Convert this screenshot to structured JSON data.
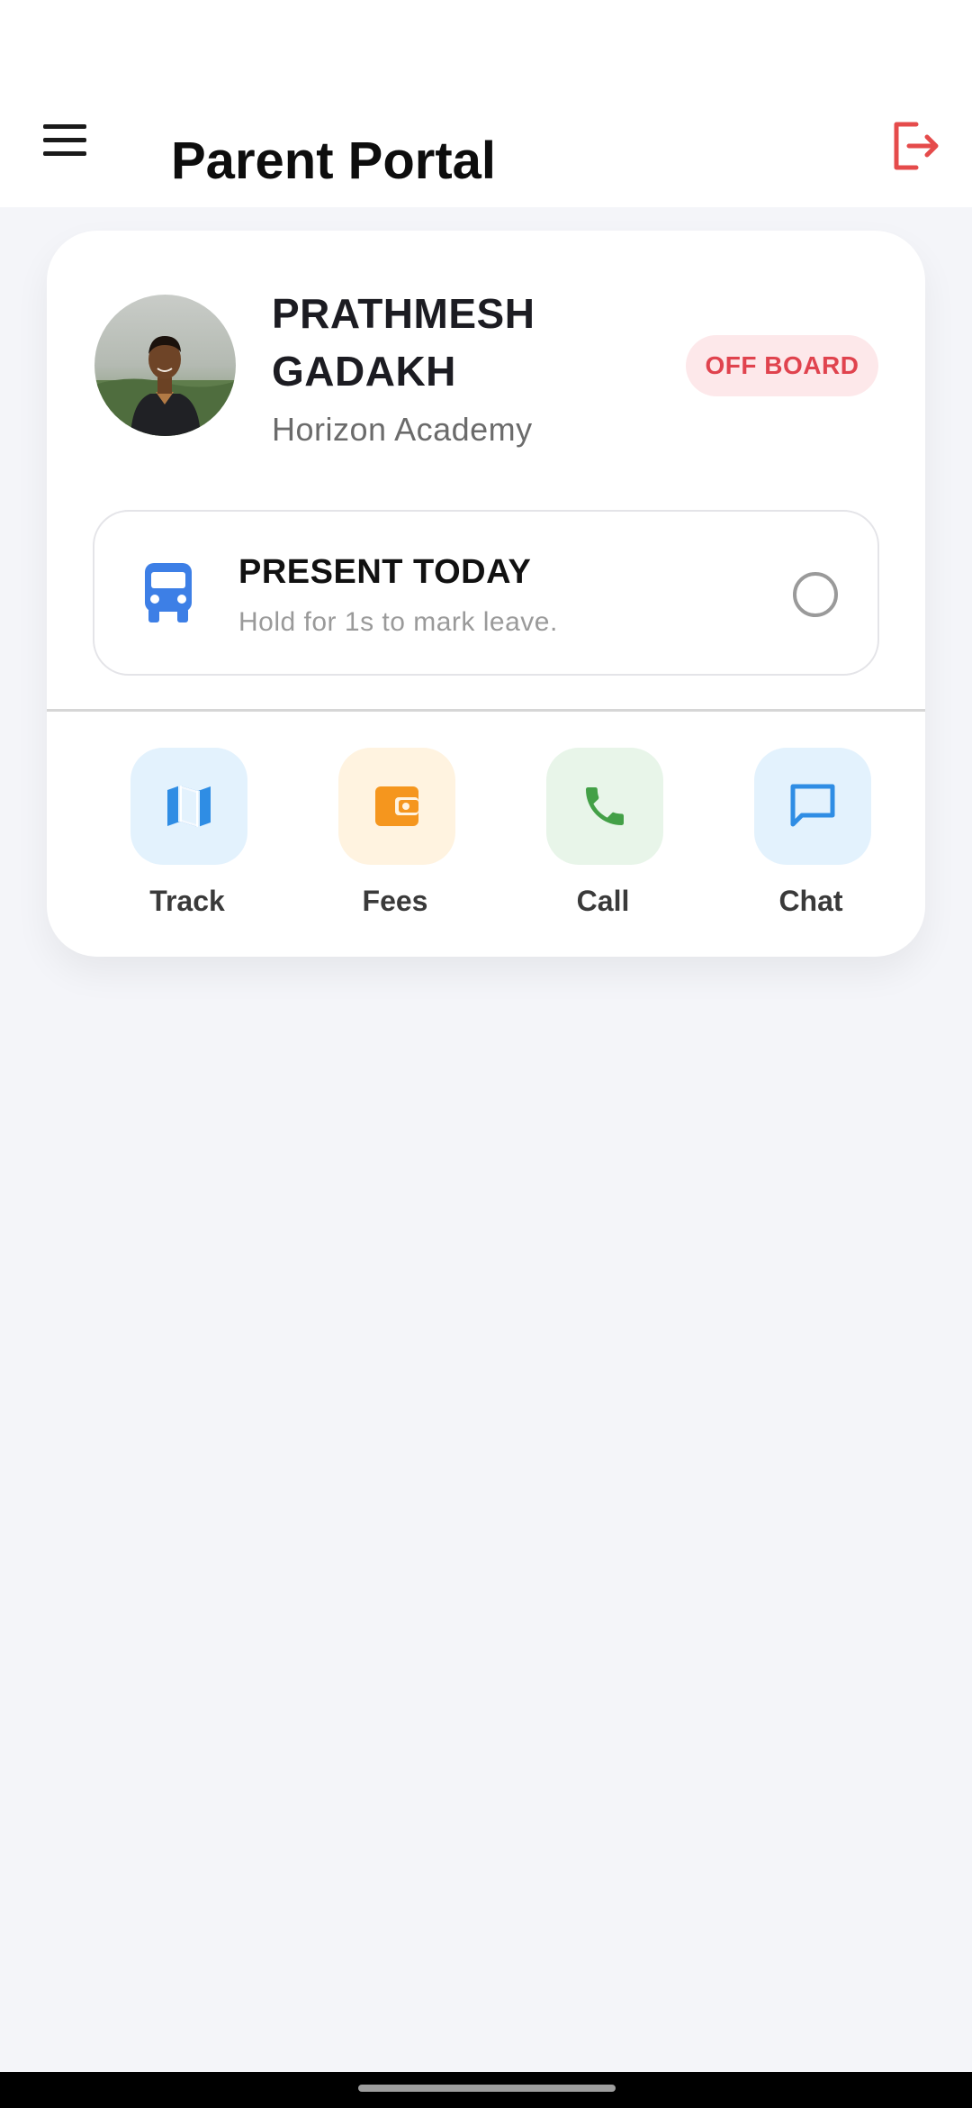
{
  "app": {
    "title": "Parent Portal"
  },
  "student": {
    "name": "PRATHMESH GADAKH",
    "school": "Horizon Academy",
    "status": "OFF BOARD"
  },
  "attendance": {
    "title": "PRESENT TODAY",
    "subtitle": "Hold for 1s to mark leave."
  },
  "actions": [
    {
      "label": "Track",
      "icon": "map-icon"
    },
    {
      "label": "Fees",
      "icon": "wallet-icon"
    },
    {
      "label": "Call",
      "icon": "phone-icon"
    },
    {
      "label": "Chat",
      "icon": "chat-icon"
    }
  ],
  "colors": {
    "accent_blue": "#2f8de4",
    "bus_blue": "#3d7fe6",
    "fees_orange": "#f5961e",
    "call_green": "#43a047",
    "logout_red": "#e54b4b",
    "badge_bg": "#fde8ea",
    "badge_text": "#e0434e"
  }
}
